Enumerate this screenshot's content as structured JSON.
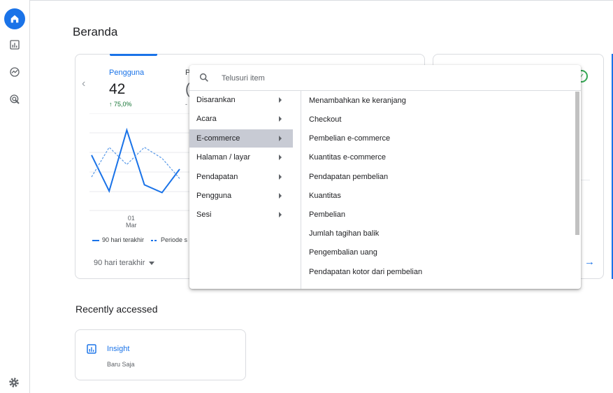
{
  "page": {
    "title": "Beranda"
  },
  "nav": {
    "items": [
      "home",
      "reports",
      "explore",
      "advertising"
    ],
    "settings": "settings"
  },
  "overview": {
    "metric1": {
      "label": "Pengguna",
      "value": "42",
      "change": "↑ 75,0%"
    },
    "metric2": {
      "label": "P",
      "value": "(",
      "change": "-"
    },
    "chart_data": {
      "type": "line",
      "x_tick_day": "01",
      "x_tick_month": "Mar",
      "series": [
        {
          "name": "90 hari terakhir",
          "values": [
            3.5,
            1.2,
            5.1,
            1.6,
            1.1,
            2.6
          ]
        },
        {
          "name": "Periode s",
          "values": [
            2.1,
            4.0,
            2.9,
            4.0,
            3.3,
            2.0
          ]
        }
      ]
    },
    "legend": {
      "current": "90 hari terakhir",
      "previous": "Periode s"
    },
    "period_selector": "90 hari terakhir"
  },
  "recent": {
    "title": "Recently accessed",
    "card": {
      "title": "Insight",
      "subtitle": "Baru Saja"
    }
  },
  "popup": {
    "search_placeholder": "Telusuri item",
    "categories": [
      {
        "label": "Disarankan"
      },
      {
        "label": "Acara"
      },
      {
        "label": "E-commerce",
        "selected": true
      },
      {
        "label": "Halaman / layar"
      },
      {
        "label": "Pendapatan"
      },
      {
        "label": "Pengguna"
      },
      {
        "label": "Sesi"
      }
    ],
    "items": [
      "Menambahkan ke keranjang",
      "Checkout",
      "Pembelian e-commerce",
      "Kuantitas e-commerce",
      "Pendapatan pembelian",
      "Kuantitas",
      "Pembelian",
      "Jumlah tagihan balik",
      "Pengembalian uang",
      "Pendapatan kotor dari pembelian"
    ]
  },
  "colors": {
    "accent": "#1a73e8",
    "positive": "#137333",
    "selected_bg": "#c8cbd4"
  }
}
